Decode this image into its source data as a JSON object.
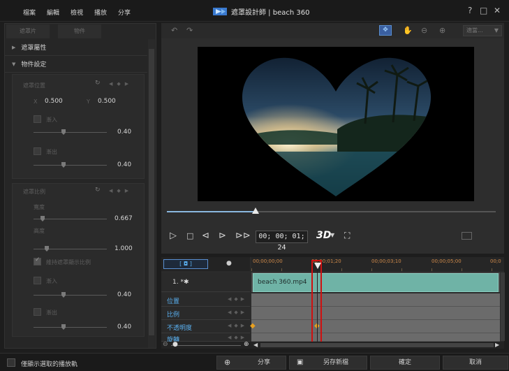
{
  "menu": [
    "檔案",
    "編輯",
    "檢視",
    "播放",
    "分享"
  ],
  "window": {
    "title": "遮罩設計師 | beach 360",
    "help": "?",
    "maximize": "□",
    "close": "✕"
  },
  "left_panel": {
    "tabs": [
      "遮罩片",
      "物件"
    ],
    "sections": {
      "mask_props": "遮罩屬性",
      "object_settings": "物件設定"
    },
    "position": {
      "title": "遮罩位置",
      "x_label": "X",
      "x_value": "0.500",
      "y_label": "Y",
      "y_value": "0.500",
      "fade_in_label": "漸入",
      "fade_in_value": "0.40",
      "fade_out_label": "漸出",
      "fade_out_value": "0.40"
    },
    "scale": {
      "title": "遮罩比例",
      "width_label": "寬度",
      "width_value": "0.667",
      "height_label": "高度",
      "height_value": "1.000",
      "keep_ratio_label": "維持遮罩顯示比例",
      "fade_in_label": "漸入",
      "fade_in_value": "0.40",
      "fade_out_label": "漸出",
      "fade_out_value": "0.40"
    }
  },
  "preview": {
    "zoom_label": "適當...",
    "progress": 0.27
  },
  "transport": {
    "timecode": "00; 00; 01; 24",
    "btn_3d": "3D"
  },
  "timeline": {
    "ruler": [
      "00;00;00;00",
      "00;00;01;20",
      "00;00;03;10",
      "00;00;05;00",
      "00;0"
    ],
    "track_name": "1. *✱",
    "clip_name": "beach 360.mp4",
    "rows": [
      "位置",
      "比例",
      "不透明度",
      "旋轉"
    ]
  },
  "bottom_bar": {
    "only_selected_label": "僅顯示選取的播放軌",
    "share_label": "分享",
    "save_new_label": "另存新檔",
    "ok_label": "確定",
    "cancel_label": "取消"
  },
  "colors": {
    "accent": "#5ab0f0",
    "clip": "#6fb3a6",
    "playhead_box": "#d01010",
    "ruler_text": "#d08a4a"
  }
}
